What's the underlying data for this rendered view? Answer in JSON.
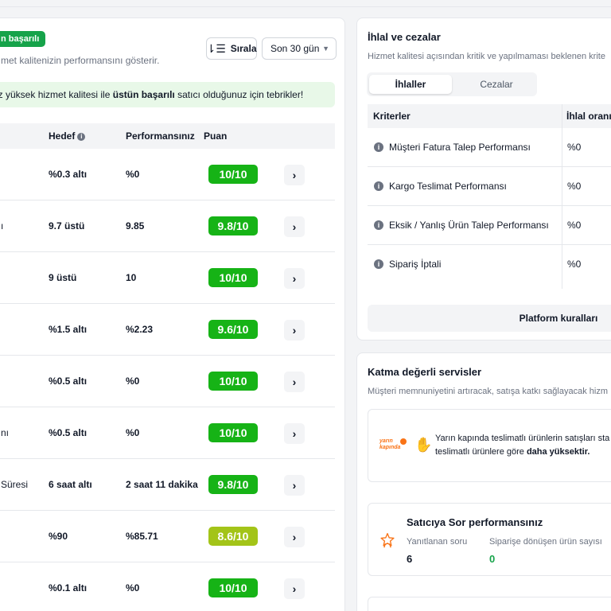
{
  "left": {
    "badge": "n başarılı",
    "subtitle": "met kalitenizin performansını gösterir.",
    "sort_label": "Sırala",
    "period": "Son 30 gün",
    "banner_pre": "uz yüksek hizmet kalitesi ile ",
    "banner_bold": "üstün başarılı",
    "banner_post": " satıcı olduğunuz için tebrikler!",
    "headers": {
      "target": "Hedef",
      "performance": "Performansınız",
      "score": "Puan"
    },
    "rows": [
      {
        "name": "",
        "target": "%0.3 altı",
        "perf": "%0",
        "score": "10/10"
      },
      {
        "name": "ı",
        "target": "9.7 üstü",
        "perf": "9.85",
        "score": "9.8/10"
      },
      {
        "name": "",
        "target": "9 üstü",
        "perf": "10",
        "score": "10/10"
      },
      {
        "name": "",
        "target": "%1.5 altı",
        "perf": "%2.23",
        "score": "9.6/10"
      },
      {
        "name": "",
        "target": "%0.5 altı",
        "perf": "%0",
        "score": "10/10"
      },
      {
        "name": "nı",
        "target": "%0.5 altı",
        "perf": "%0",
        "score": "10/10"
      },
      {
        "name": "Süresi",
        "target": "6 saat altı",
        "perf": "2 saat 11 dakika",
        "score": "9.8/10"
      },
      {
        "name": "",
        "target": "%90",
        "perf": "%85.71",
        "score": "8.6/10"
      },
      {
        "name": "",
        "target": "%0.1 altı",
        "perf": "%0",
        "score": "10/10"
      }
    ],
    "score_colors": [
      "#16b316",
      "#16b316",
      "#16b316",
      "#16b316",
      "#16b316",
      "#16b316",
      "#16b316",
      "#a3c418",
      "#16b316"
    ]
  },
  "violations": {
    "title": "İhlal ve cezalar",
    "subtitle": "Hizmet kalitesi açısından kritik ve yapılmaması beklenen krite",
    "tab_active": "İhlaller",
    "tab_inactive": "Cezalar",
    "col_criteria": "Kriterler",
    "col_rate": "İhlal oranın",
    "rows": [
      {
        "label": "Müşteri Fatura Talep Performansı",
        "value": "%0"
      },
      {
        "label": "Kargo Teslimat Performansı",
        "value": "%0"
      },
      {
        "label": "Eksik / Yanlış Ürün Talep Performansı",
        "value": "%0"
      },
      {
        "label": "Sipariş İptali",
        "value": "%0"
      }
    ],
    "rules_button": "Platform kuralları"
  },
  "services": {
    "title": "Katma değerli servisler",
    "subtitle": "Müşteri memnuniyetini artıracak, satışa katkı sağlayacak hizm",
    "logo_line1": "yarın",
    "logo_line2": "kapında",
    "info_line1": "Yarın kapında teslimatlı ürünlerin satışları sta",
    "info_line2_pre": "teslimatlı ürünlere göre ",
    "info_line2_bold": "daha yüksektir.",
    "perf_title": "Satıcıya Sor performansınız",
    "answered_label": "Yanıtlanan soru",
    "answered_value": "6",
    "converted_label": "Siparişe dönüşen ürün sayısı",
    "converted_value": "0"
  }
}
